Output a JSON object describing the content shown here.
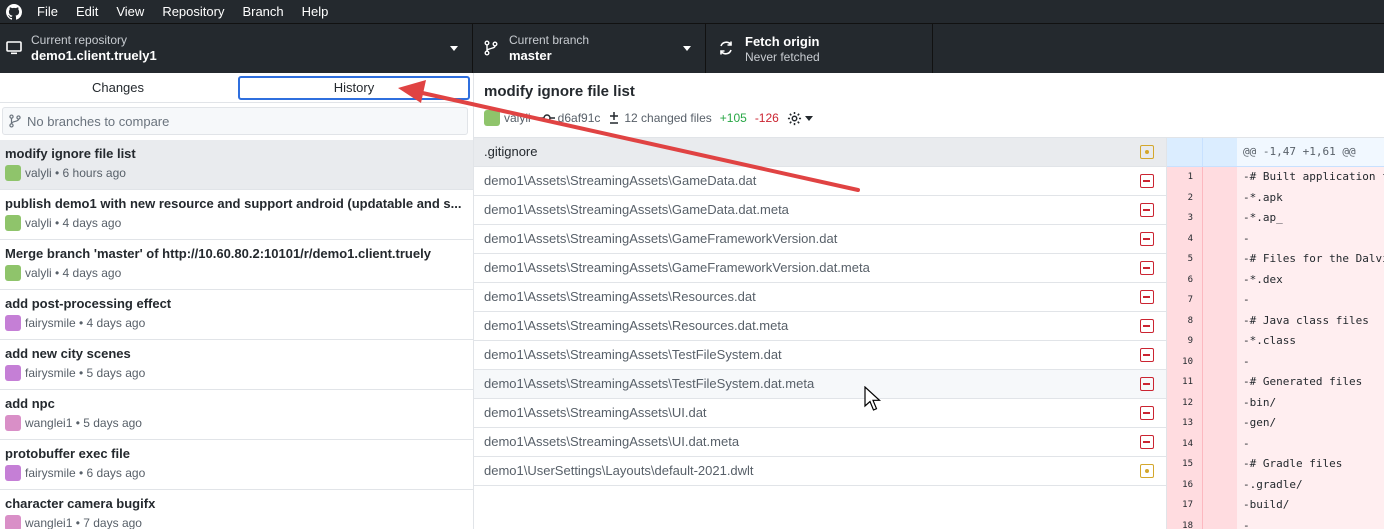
{
  "menubar": {
    "items": [
      "File",
      "Edit",
      "View",
      "Repository",
      "Branch",
      "Help"
    ]
  },
  "toolbar": {
    "repo": {
      "label": "Current repository",
      "value": "demo1.client.truely1"
    },
    "branch": {
      "label": "Current branch",
      "value": "master"
    },
    "fetch": {
      "label": "Fetch origin",
      "value": "Never fetched"
    }
  },
  "sidebar": {
    "tabs": [
      "Changes",
      "History"
    ],
    "active_tab": "History",
    "compare_placeholder": "No branches to compare",
    "commits": [
      {
        "title": "modify ignore file list",
        "author": "valyli",
        "time": "6 hours ago",
        "selected": true,
        "avatar_color": "#8fc46b"
      },
      {
        "title": "publish demo1 with new resource and support android (updatable and s...",
        "author": "valyli",
        "time": "4 days ago",
        "avatar_color": "#8fc46b"
      },
      {
        "title": "Merge branch 'master' of http://10.60.80.2:10101/r/demo1.client.truely",
        "author": "valyli",
        "time": "4 days ago",
        "avatar_color": "#8fc46b"
      },
      {
        "title": "add post-processing effect",
        "author": "fairysmile",
        "time": "4 days ago",
        "avatar_color": "#c57fd6"
      },
      {
        "title": "add new city scenes",
        "author": "fairysmile",
        "time": "5 days ago",
        "avatar_color": "#c57fd6"
      },
      {
        "title": "add npc",
        "author": "wanglei1",
        "time": "5 days ago",
        "avatar_color": "#d98fc7"
      },
      {
        "title": "protobuffer exec file",
        "author": "fairysmile",
        "time": "6 days ago",
        "avatar_color": "#c57fd6"
      },
      {
        "title": "character camera bugifx",
        "author": "wanglei1",
        "time": "7 days ago",
        "avatar_color": "#d98fc7"
      }
    ]
  },
  "commit_detail": {
    "title": "modify ignore file list",
    "author": "valyli",
    "sha": "d6af91c",
    "changed_files": "12 changed files",
    "additions": "+105",
    "deletions": "-126"
  },
  "files": [
    {
      "path": ".gitignore",
      "status": "modified",
      "selected": true
    },
    {
      "path": "demo1\\Assets\\StreamingAssets\\GameData.dat",
      "status": "deleted"
    },
    {
      "path": "demo1\\Assets\\StreamingAssets\\GameData.dat.meta",
      "status": "deleted"
    },
    {
      "path": "demo1\\Assets\\StreamingAssets\\GameFrameworkVersion.dat",
      "status": "deleted"
    },
    {
      "path": "demo1\\Assets\\StreamingAssets\\GameFrameworkVersion.dat.meta",
      "status": "deleted"
    },
    {
      "path": "demo1\\Assets\\StreamingAssets\\Resources.dat",
      "status": "deleted"
    },
    {
      "path": "demo1\\Assets\\StreamingAssets\\Resources.dat.meta",
      "status": "deleted"
    },
    {
      "path": "demo1\\Assets\\StreamingAssets\\TestFileSystem.dat",
      "status": "deleted"
    },
    {
      "path": "demo1\\Assets\\StreamingAssets\\TestFileSystem.dat.meta",
      "status": "deleted",
      "hover": true
    },
    {
      "path": "demo1\\Assets\\StreamingAssets\\UI.dat",
      "status": "deleted"
    },
    {
      "path": "demo1\\Assets\\StreamingAssets\\UI.dat.meta",
      "status": "deleted"
    },
    {
      "path": "demo1\\UserSettings\\Layouts\\default-2021.dwlt",
      "status": "modified"
    }
  ],
  "diff": {
    "hunk": "@@ -1,47 +1,61 @@",
    "lines": [
      {
        "num": "1",
        "text": "-# Built application fi"
      },
      {
        "num": "2",
        "text": "-*.apk"
      },
      {
        "num": "3",
        "text": "-*.ap_"
      },
      {
        "num": "4",
        "text": "-"
      },
      {
        "num": "5",
        "text": "-# Files for the Dalvik"
      },
      {
        "num": "6",
        "text": "-*.dex"
      },
      {
        "num": "7",
        "text": "-"
      },
      {
        "num": "8",
        "text": "-# Java class files"
      },
      {
        "num": "9",
        "text": "-*.class"
      },
      {
        "num": "10",
        "text": "-"
      },
      {
        "num": "11",
        "text": "-# Generated files"
      },
      {
        "num": "12",
        "text": "-bin/"
      },
      {
        "num": "13",
        "text": "-gen/"
      },
      {
        "num": "14",
        "text": "-"
      },
      {
        "num": "15",
        "text": "-# Gradle files"
      },
      {
        "num": "16",
        "text": "-.gradle/"
      },
      {
        "num": "17",
        "text": "-build/"
      },
      {
        "num": "18",
        "text": "-"
      }
    ]
  },
  "colors": {
    "toolbar_bg": "#24292e",
    "accent": "#2f6fde",
    "annotation_arrow": "#e04343",
    "deleted": "#cb2431",
    "modified": "#d4a72c"
  }
}
